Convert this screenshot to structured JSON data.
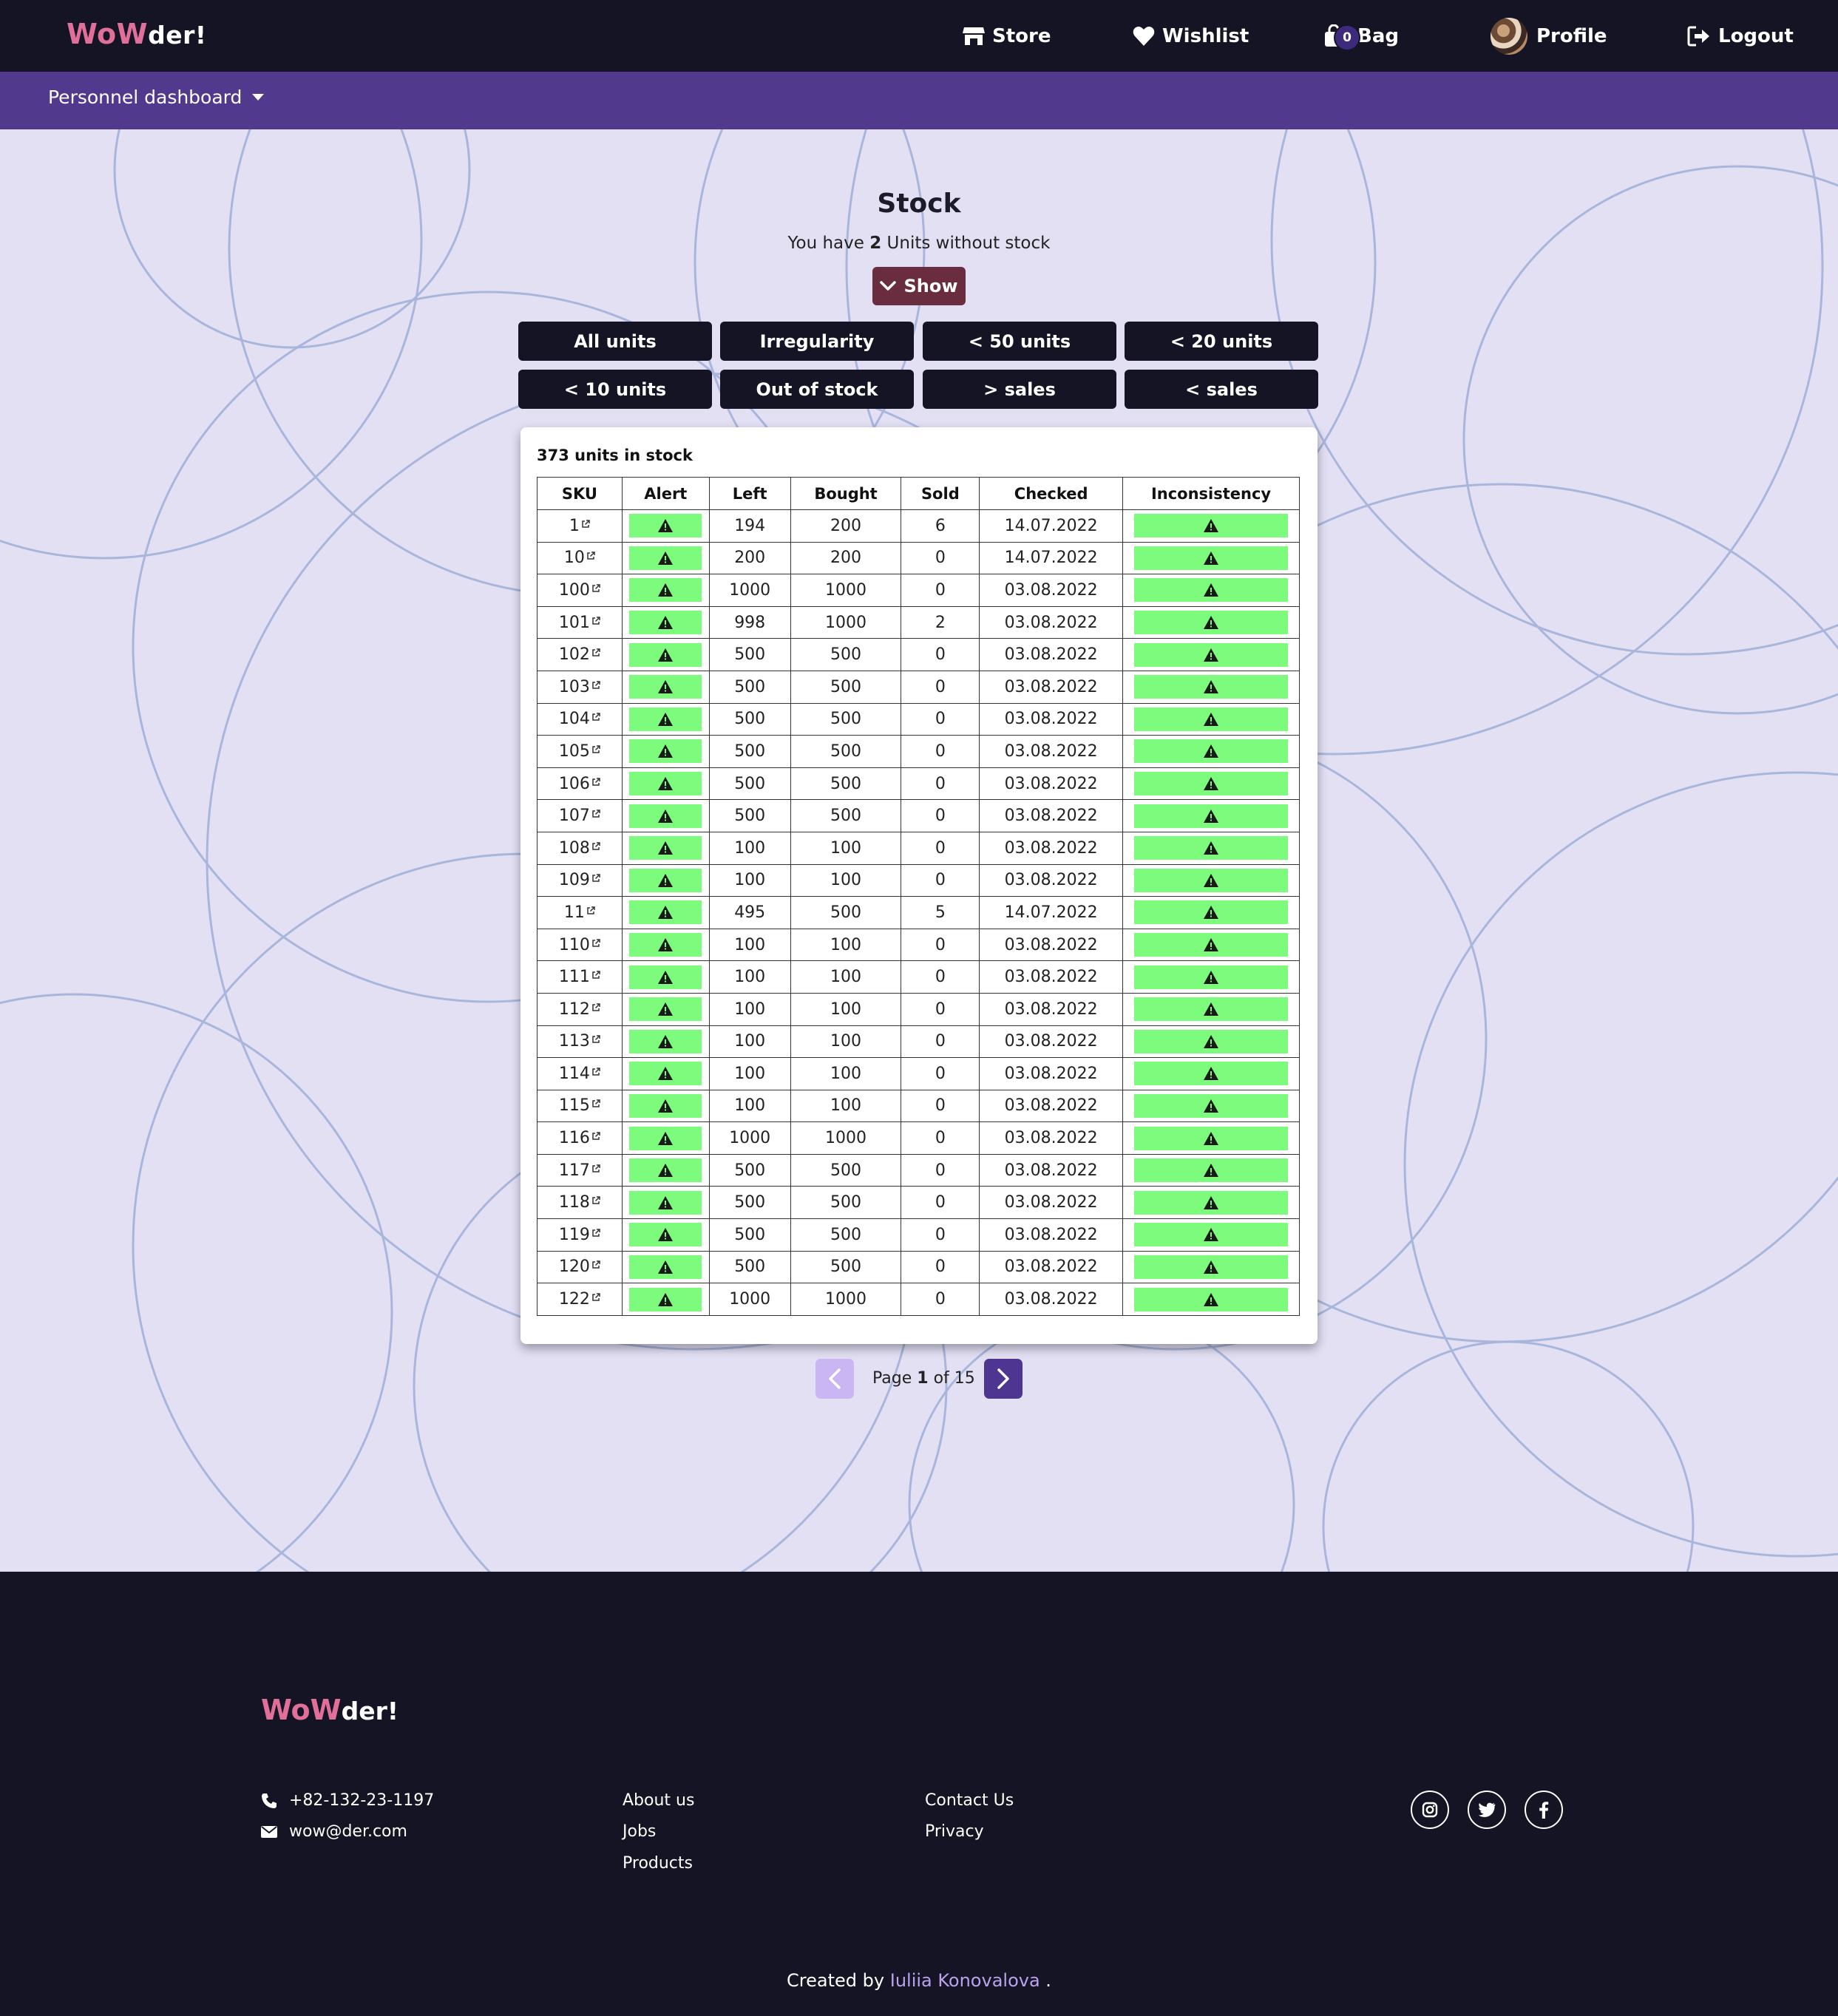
{
  "brand": {
    "wow": "WoW",
    "der": "der!"
  },
  "nav": {
    "store": "Store",
    "wishlist": "Wishlist",
    "bag": "Bag",
    "bag_count": "0",
    "profile": "Profile",
    "logout": "Logout"
  },
  "subnav": {
    "dashboard": "Personnel dashboard"
  },
  "page": {
    "title": "Stock",
    "subtitle_prefix": "You have",
    "subtitle_count": "2",
    "subtitle_suffix": "Units without stock",
    "show_button": "Show"
  },
  "filters": [
    "All units",
    "Irregularity",
    "< 50 units",
    "< 20 units",
    "< 10 units",
    "Out of stock",
    "> sales",
    "< sales"
  ],
  "stock": {
    "summary": "373 units in stock",
    "columns": [
      "SKU",
      "Alert",
      "Left",
      "Bought",
      "Sold",
      "Checked",
      "Inconsistency"
    ],
    "rows": [
      {
        "sku": "1",
        "left": "194",
        "bought": "200",
        "sold": "6",
        "checked": "14.07.2022"
      },
      {
        "sku": "10",
        "left": "200",
        "bought": "200",
        "sold": "0",
        "checked": "14.07.2022"
      },
      {
        "sku": "100",
        "left": "1000",
        "bought": "1000",
        "sold": "0",
        "checked": "03.08.2022"
      },
      {
        "sku": "101",
        "left": "998",
        "bought": "1000",
        "sold": "2",
        "checked": "03.08.2022"
      },
      {
        "sku": "102",
        "left": "500",
        "bought": "500",
        "sold": "0",
        "checked": "03.08.2022"
      },
      {
        "sku": "103",
        "left": "500",
        "bought": "500",
        "sold": "0",
        "checked": "03.08.2022"
      },
      {
        "sku": "104",
        "left": "500",
        "bought": "500",
        "sold": "0",
        "checked": "03.08.2022"
      },
      {
        "sku": "105",
        "left": "500",
        "bought": "500",
        "sold": "0",
        "checked": "03.08.2022"
      },
      {
        "sku": "106",
        "left": "500",
        "bought": "500",
        "sold": "0",
        "checked": "03.08.2022"
      },
      {
        "sku": "107",
        "left": "500",
        "bought": "500",
        "sold": "0",
        "checked": "03.08.2022"
      },
      {
        "sku": "108",
        "left": "100",
        "bought": "100",
        "sold": "0",
        "checked": "03.08.2022"
      },
      {
        "sku": "109",
        "left": "100",
        "bought": "100",
        "sold": "0",
        "checked": "03.08.2022"
      },
      {
        "sku": "11",
        "left": "495",
        "bought": "500",
        "sold": "5",
        "checked": "14.07.2022"
      },
      {
        "sku": "110",
        "left": "100",
        "bought": "100",
        "sold": "0",
        "checked": "03.08.2022"
      },
      {
        "sku": "111",
        "left": "100",
        "bought": "100",
        "sold": "0",
        "checked": "03.08.2022"
      },
      {
        "sku": "112",
        "left": "100",
        "bought": "100",
        "sold": "0",
        "checked": "03.08.2022"
      },
      {
        "sku": "113",
        "left": "100",
        "bought": "100",
        "sold": "0",
        "checked": "03.08.2022"
      },
      {
        "sku": "114",
        "left": "100",
        "bought": "100",
        "sold": "0",
        "checked": "03.08.2022"
      },
      {
        "sku": "115",
        "left": "100",
        "bought": "100",
        "sold": "0",
        "checked": "03.08.2022"
      },
      {
        "sku": "116",
        "left": "1000",
        "bought": "1000",
        "sold": "0",
        "checked": "03.08.2022"
      },
      {
        "sku": "117",
        "left": "500",
        "bought": "500",
        "sold": "0",
        "checked": "03.08.2022"
      },
      {
        "sku": "118",
        "left": "500",
        "bought": "500",
        "sold": "0",
        "checked": "03.08.2022"
      },
      {
        "sku": "119",
        "left": "500",
        "bought": "500",
        "sold": "0",
        "checked": "03.08.2022"
      },
      {
        "sku": "120",
        "left": "500",
        "bought": "500",
        "sold": "0",
        "checked": "03.08.2022"
      },
      {
        "sku": "122",
        "left": "1000",
        "bought": "1000",
        "sold": "0",
        "checked": "03.08.2022"
      }
    ]
  },
  "pagination": {
    "prefix": "Page",
    "current": "1",
    "of": "of",
    "total": "15"
  },
  "footer": {
    "phone": "+82-132-23-1197",
    "email": "wow@der.com",
    "links_col1": [
      "About us",
      "Jobs",
      "Products"
    ],
    "links_col2": [
      "Contact Us",
      "Privacy"
    ],
    "social": [
      "instagram-icon",
      "twitter-icon",
      "facebook-icon"
    ],
    "credit_prefix": "Created by",
    "credit_author": "Iuliia Konovalova",
    "credit_suffix": "."
  },
  "colors": {
    "navbar": "#151424",
    "subbar": "#51398d",
    "background": "#e3e0f4",
    "accent_pink": "#e0709a",
    "show_button": "#6a2c3f",
    "alert_green": "#7dfb7d",
    "pager_active": "#4d3591",
    "pager_disabled": "#c9b6f2",
    "author_link": "#b9a2ee"
  }
}
